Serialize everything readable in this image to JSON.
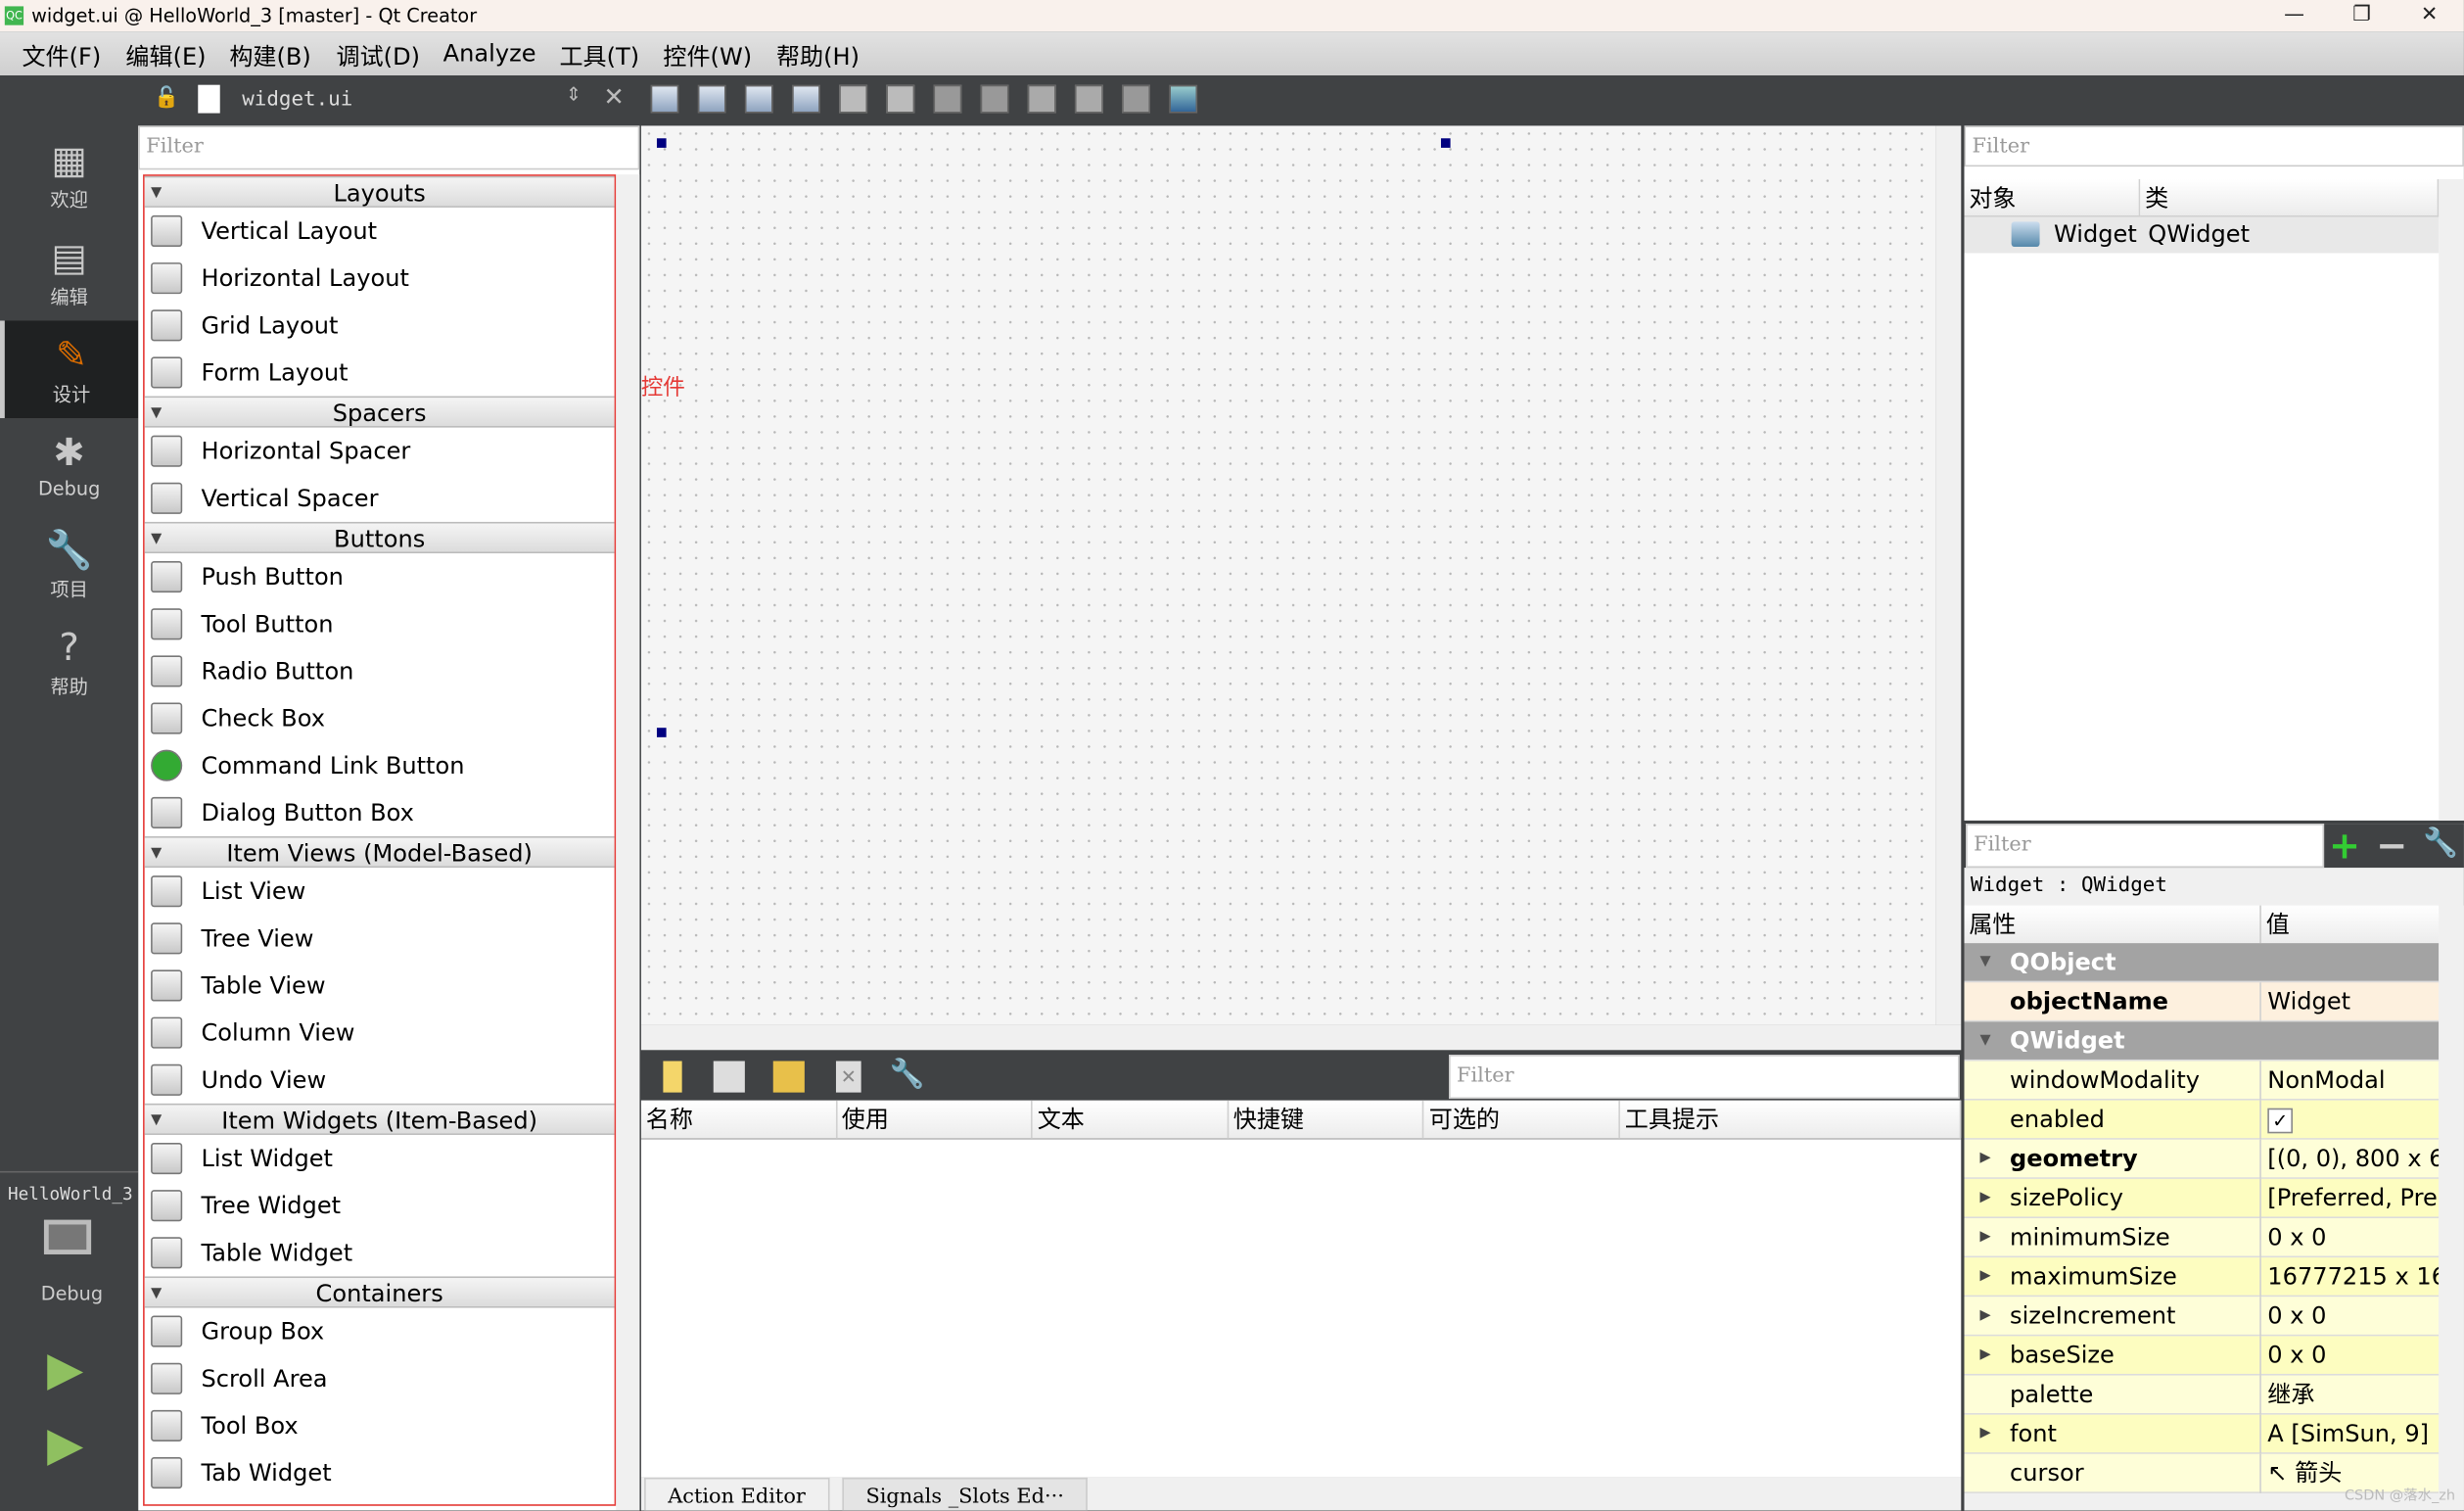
{
  "window": {
    "title": "widget.ui @ HelloWorld_3 [master] - Qt Creator",
    "min": "—",
    "max": "❐",
    "close": "✕"
  },
  "menu": [
    "文件(F)",
    "编辑(E)",
    "构建(B)",
    "调试(D)",
    "Analyze",
    "工具(T)",
    "控件(W)",
    "帮助(H)"
  ],
  "modes": [
    {
      "label": "欢迎",
      "icon": "grid-icon",
      "glyph": "▦"
    },
    {
      "label": "编辑",
      "icon": "document-icon",
      "glyph": "▤"
    },
    {
      "label": "设计",
      "icon": "pencil-icon",
      "glyph": "✎",
      "active": true
    },
    {
      "label": "Debug",
      "icon": "bug-icon",
      "glyph": "✱"
    },
    {
      "label": "项目",
      "icon": "wrench-icon",
      "glyph": "🔧"
    },
    {
      "label": "帮助",
      "icon": "help-icon",
      "glyph": "?"
    }
  ],
  "kit": {
    "project": "HelloWorld_3",
    "build": "Debug"
  },
  "editor": {
    "file": "widget.ui"
  },
  "widgetbox": {
    "filter_placeholder": "Filter",
    "categories": [
      {
        "name": "Layouts",
        "items": [
          "Vertical Layout",
          "Horizontal Layout",
          "Grid Layout",
          "Form Layout"
        ]
      },
      {
        "name": "Spacers",
        "items": [
          "Horizontal Spacer",
          "Vertical Spacer"
        ]
      },
      {
        "name": "Buttons",
        "items": [
          "Push Button",
          "Tool Button",
          "Radio Button",
          "Check Box",
          "Command Link Button",
          "Dialog Button Box"
        ]
      },
      {
        "name": "Item Views (Model-Based)",
        "items": [
          "List View",
          "Tree View",
          "Table View",
          "Column View",
          "Undo View"
        ]
      },
      {
        "name": "Item Widgets (Item-Based)",
        "items": [
          "List Widget",
          "Tree Widget",
          "Table Widget"
        ]
      },
      {
        "name": "Containers",
        "items": [
          "Group Box",
          "Scroll Area",
          "Tool Box",
          "Tab Widget"
        ]
      }
    ]
  },
  "annotation": {
    "text": "控件",
    "color": "#e53935"
  },
  "action_editor": {
    "filter_placeholder": "Filter",
    "columns": [
      "名称",
      "使用",
      "文本",
      "快捷键",
      "可选的",
      "工具提示"
    ],
    "tabs": [
      "Action Editor",
      "Signals _Slots Ed···"
    ]
  },
  "object_inspector": {
    "filter_placeholder": "Filter",
    "columns": [
      "对象",
      "类"
    ],
    "rows": [
      {
        "object": "Widget",
        "class": "QWidget"
      }
    ]
  },
  "property_editor": {
    "filter_placeholder": "Filter",
    "context": "Widget : QWidget",
    "columns": [
      "属性",
      "值"
    ],
    "rows": [
      {
        "group": true,
        "name": "QObject"
      },
      {
        "name": "objectName",
        "value": "Widget",
        "bold": true,
        "bg": "#fdf0de"
      },
      {
        "group": true,
        "name": "QWidget"
      },
      {
        "name": "windowModality",
        "value": "NonModal",
        "bg": "#fefed8"
      },
      {
        "name": "enabled",
        "value": "✓",
        "checkbox": true,
        "bg": "#fdfdc0"
      },
      {
        "name": "geometry",
        "value": "[(0, 0), 800 x 6...",
        "bold": true,
        "expand": true,
        "bg": "#fefed8"
      },
      {
        "name": "sizePolicy",
        "value": "[Preferred, Pre...",
        "expand": true,
        "bg": "#fdfdc0"
      },
      {
        "name": "minimumSize",
        "value": "0 x 0",
        "expand": true,
        "bg": "#fefed8"
      },
      {
        "name": "maximumSize",
        "value": "16777215 x 16...",
        "expand": true,
        "bg": "#fdfdc0"
      },
      {
        "name": "sizeIncrement",
        "value": "0 x 0",
        "expand": true,
        "bg": "#fefed8"
      },
      {
        "name": "baseSize",
        "value": "0 x 0",
        "expand": true,
        "bg": "#fdfdc0"
      },
      {
        "name": "palette",
        "value": "继承",
        "bg": "#fefed8"
      },
      {
        "name": "font",
        "value": "A  [SimSun, 9]",
        "expand": true,
        "bg": "#fdfdc0"
      },
      {
        "name": "cursor",
        "value": "↖  箭头",
        "bg": "#fefed8"
      }
    ]
  },
  "watermark": "CSDN @落水_zh"
}
